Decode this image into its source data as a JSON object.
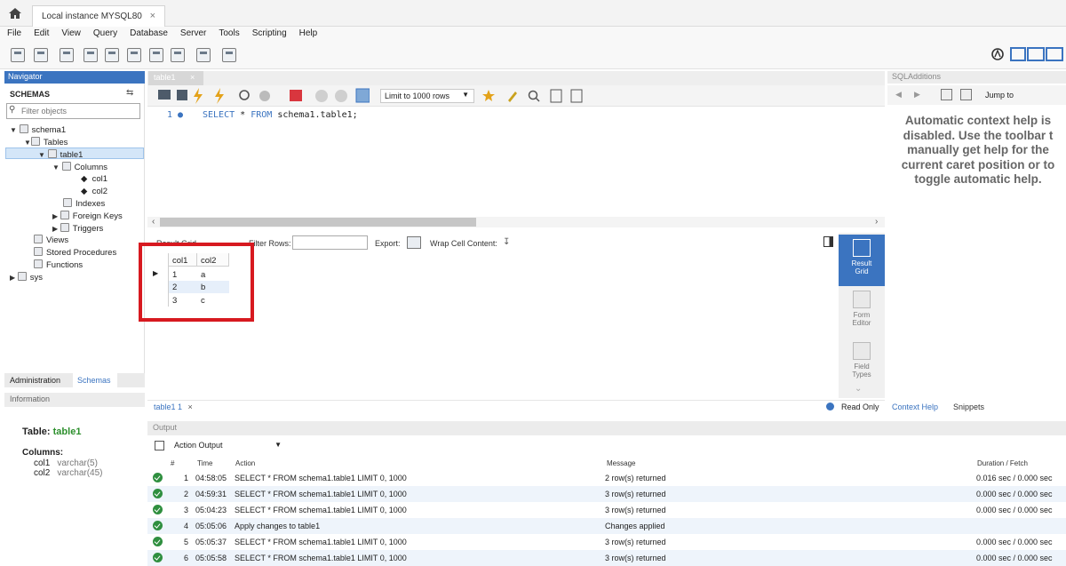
{
  "window": {
    "tab_title": "Local instance MYSQL80",
    "tab_close": "×"
  },
  "menu": [
    "File",
    "Edit",
    "View",
    "Query",
    "Database",
    "Server",
    "Tools",
    "Scripting",
    "Help"
  ],
  "navigator": {
    "title": "Navigator",
    "schemas_label": "SCHEMAS",
    "filter_placeholder": "Filter objects",
    "tree": {
      "schema1": "schema1",
      "tables": "Tables",
      "table1": "table1",
      "columns": "Columns",
      "col1": "col1",
      "col2": "col2",
      "indexes": "Indexes",
      "foreign_keys": "Foreign Keys",
      "triggers": "Triggers",
      "views": "Views",
      "stored_procedures": "Stored Procedures",
      "functions": "Functions",
      "sys": "sys"
    },
    "tabs": {
      "administration": "Administration",
      "schemas": "Schemas"
    }
  },
  "information": {
    "title": "Information",
    "table_label": "Table:",
    "table_name": "table1",
    "columns_label": "Columns:",
    "columns": [
      {
        "name": "col1",
        "type": "varchar(5)"
      },
      {
        "name": "col2",
        "type": "varchar(45)"
      }
    ]
  },
  "editor": {
    "tab": "table1",
    "limit": "Limit to 1000 rows",
    "line_number": "1",
    "sql_kw1": "SELECT",
    "sql_star": "*",
    "sql_kw2": "FROM",
    "sql_rest": "schema1.table1;"
  },
  "result": {
    "toolbar": {
      "result_grid": "Result Grid",
      "filter_rows": "Filter Rows:",
      "export": "Export:",
      "wrap": "Wrap Cell Content:"
    },
    "columns": [
      "col1",
      "col2"
    ],
    "rows": [
      [
        "1",
        "a"
      ],
      [
        "2",
        "b"
      ],
      [
        "3",
        "c"
      ]
    ],
    "side": {
      "result_grid_1": "Result",
      "result_grid_2": "Grid",
      "form_editor_1": "Form",
      "form_editor_2": "Editor",
      "field_types_1": "Field",
      "field_types_2": "Types"
    },
    "result_tab": "table1 1",
    "read_only": "Read Only"
  },
  "output": {
    "title": "Output",
    "selector": "Action Output",
    "columns": {
      "num": "#",
      "time": "Time",
      "action": "Action",
      "message": "Message",
      "duration": "Duration / Fetch"
    },
    "rows": [
      {
        "n": "1",
        "time": "04:58:05",
        "action": "SELECT * FROM schema1.table1 LIMIT 0, 1000",
        "message": "2 row(s) returned",
        "duration": "0.016 sec / 0.000 sec"
      },
      {
        "n": "2",
        "time": "04:59:31",
        "action": "SELECT * FROM schema1.table1 LIMIT 0, 1000",
        "message": "3 row(s) returned",
        "duration": "0.000 sec / 0.000 sec"
      },
      {
        "n": "3",
        "time": "05:04:23",
        "action": "SELECT * FROM schema1.table1 LIMIT 0, 1000",
        "message": "3 row(s) returned",
        "duration": "0.000 sec / 0.000 sec"
      },
      {
        "n": "4",
        "time": "05:05:06",
        "action": "Apply changes to table1",
        "message": "Changes applied",
        "duration": ""
      },
      {
        "n": "5",
        "time": "05:05:37",
        "action": "SELECT * FROM schema1.table1 LIMIT 0, 1000",
        "message": "3 row(s) returned",
        "duration": "0.000 sec / 0.000 sec"
      },
      {
        "n": "6",
        "time": "05:05:58",
        "action": "SELECT * FROM schema1.table1 LIMIT 0, 1000",
        "message": "3 row(s) returned",
        "duration": "0.000 sec / 0.000 sec"
      }
    ]
  },
  "sql_additions": {
    "title": "SQLAdditions",
    "jump_to": "Jump to",
    "help_text": "Automatic context help is disabled. Use the toolbar t manually get help for the current caret position or to toggle automatic help.",
    "tabs": {
      "context_help": "Context Help",
      "snippets": "Snippets"
    }
  },
  "colors": {
    "accent": "#3b74c0",
    "highlight": "#d71920",
    "ok": "#2f8f3f"
  }
}
